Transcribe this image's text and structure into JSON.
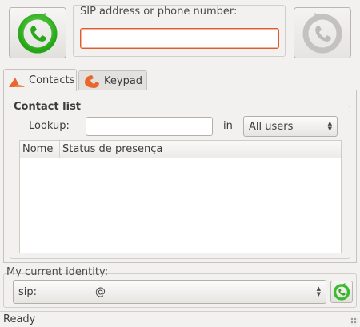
{
  "header": {
    "sip_label": "SIP address or phone number:",
    "sip_value": "",
    "call_icon": "call-icon",
    "hangup_icon": "hangup-icon"
  },
  "tabs": [
    {
      "label": "Contacts",
      "icon": "contacts-icon",
      "active": true
    },
    {
      "label": "Keypad",
      "icon": "keypad-icon",
      "active": false
    }
  ],
  "contacts": {
    "group_label": "Contact list",
    "lookup_label": "Lookup:",
    "lookup_value": "",
    "in_label": "in",
    "filter_selected": "All users",
    "columns": [
      "Nome",
      "Status de presença"
    ],
    "rows": []
  },
  "identity": {
    "label": "My current identity:",
    "prefix": "sip:",
    "at": "@"
  },
  "status": {
    "text": "Ready"
  },
  "colors": {
    "call_green": "#3dbb2f",
    "focus_orange": "#e05a2a",
    "background": "#f2f1f0"
  }
}
